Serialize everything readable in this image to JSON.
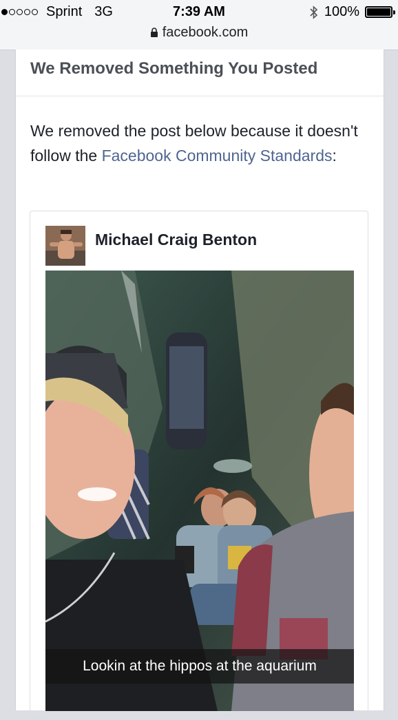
{
  "status_bar": {
    "signal_bars_filled": 1,
    "signal_bars_total": 5,
    "carrier": "Sprint",
    "network": "3G",
    "time": "7:39 AM",
    "battery_percent": "100%",
    "battery_level": 1.0,
    "url": "facebook.com"
  },
  "card": {
    "title": "We Removed Something You Posted",
    "message_prefix": "We removed the post below because it doesn't follow the ",
    "message_link": "Facebook Community Standards",
    "message_suffix": ":"
  },
  "post": {
    "author": "Michael Craig Benton",
    "caption": "Lookin at the hippos at the aquarium"
  },
  "colors": {
    "link": "#4e6591",
    "header_text": "#4b4f56",
    "body_text": "#1d2129"
  }
}
